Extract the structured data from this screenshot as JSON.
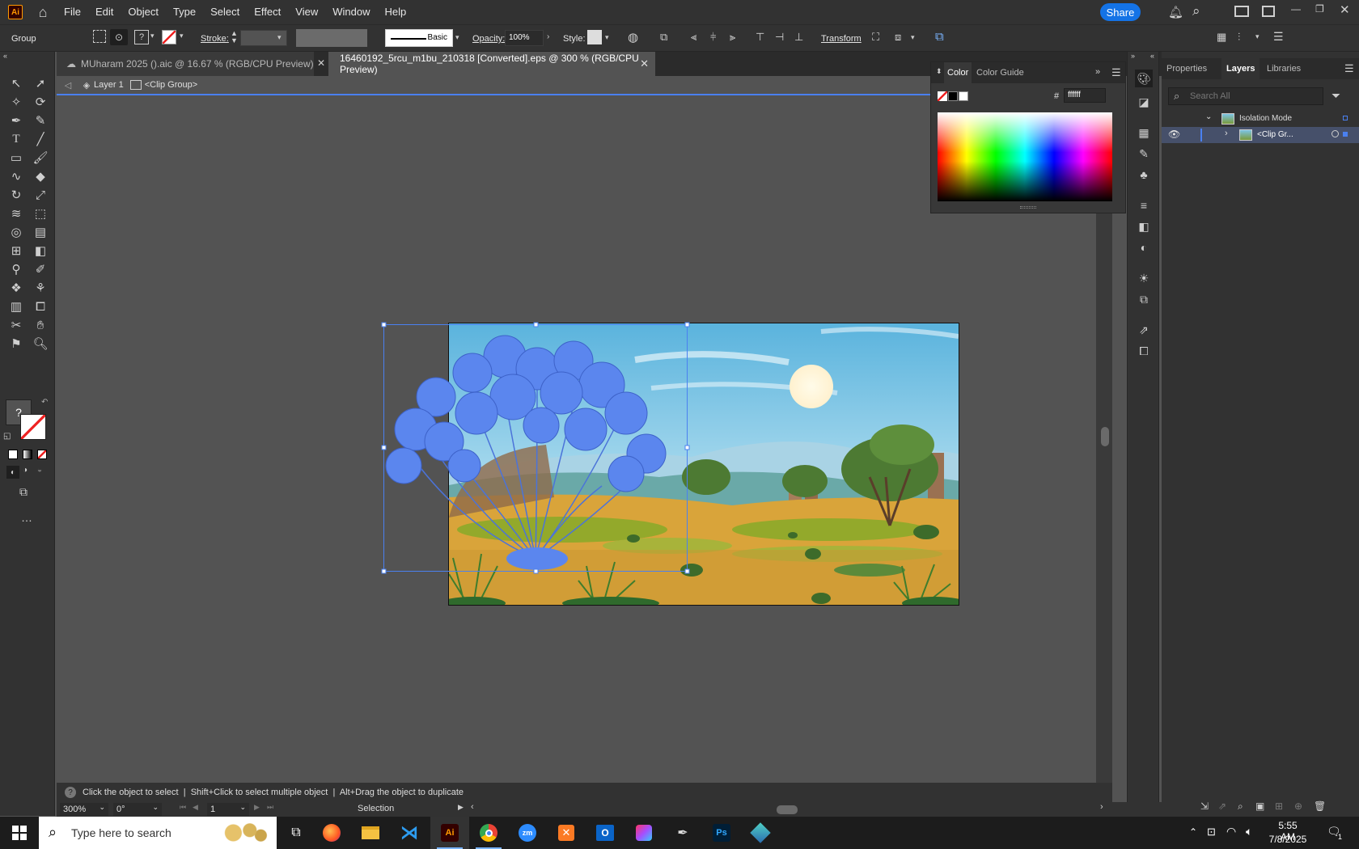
{
  "app": {
    "logo_text": "Ai",
    "accent": "#ff9a00",
    "selection_color": "#4a80f0"
  },
  "menu": [
    "File",
    "Edit",
    "Object",
    "Type",
    "Select",
    "Effect",
    "View",
    "Window",
    "Help"
  ],
  "share_label": "Share",
  "control_bar": {
    "selection_type": "Group",
    "stroke_label": "Stroke:",
    "brush_label": "Basic",
    "opacity_label": "Opacity:",
    "opacity_value": "100%",
    "style_label": "Style:",
    "transform_label": "Transform"
  },
  "tabs": [
    {
      "label": "MUharam 2025 ().aic @ 16.67 % (RGB/CPU Preview)",
      "active": false
    },
    {
      "label": "16460192_5rcu_m1bu_210318 [Converted].eps @ 300 % (RGB/CPU Preview)",
      "active": true
    }
  ],
  "breadcrumb": {
    "layer": "Layer 1",
    "group": "<Clip Group>"
  },
  "color_panel": {
    "tabs": [
      "Color",
      "Color Guide"
    ],
    "hex_prefix": "#",
    "hex_value": "ffffff"
  },
  "layers_panel": {
    "tabs": [
      "Properties",
      "Layers",
      "Libraries"
    ],
    "active_tab": "Layers",
    "search_placeholder": "Search All",
    "rows": [
      {
        "label": "Isolation Mode"
      },
      {
        "label": "<Clip Gr..."
      }
    ]
  },
  "status": {
    "help_text": "Click the object to select  |  Shift+Click to select multiple object  |  Alt+Drag the object to duplicate",
    "zoom": "300%",
    "rotation": "0°",
    "artboard": "1",
    "tool": "Selection"
  },
  "taskbar": {
    "search_placeholder": "Type here to search",
    "time": "5:55 AM",
    "date": "7/8/2025",
    "notification_count": "1",
    "apps": [
      "firefox",
      "file-explorer",
      "vscode",
      "illustrator",
      "chrome",
      "zoom",
      "xampp",
      "outlook",
      "creative-cloud",
      "pen-tool",
      "photoshop",
      "app"
    ]
  }
}
